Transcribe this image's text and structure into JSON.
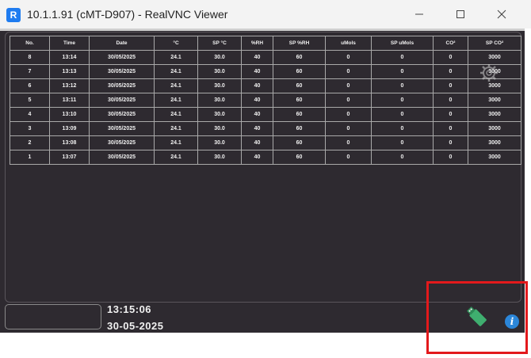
{
  "window": {
    "title": "10.1.1.91 (cMT-D907) - RealVNC Viewer",
    "app_icon_glyph": "R",
    "icons": [
      "realvnc-app-icon",
      "minimize-icon",
      "maximize-icon",
      "close-icon"
    ]
  },
  "table": {
    "headers": [
      "No.",
      "Time",
      "Date",
      "°C",
      "SP °C",
      "%RH",
      "SP %RH",
      "uMols",
      "SP uMols",
      "CO²",
      "SP CO²"
    ],
    "rows": [
      [
        "8",
        "13:14",
        "30/05/2025",
        "24.1",
        "30.0",
        "40",
        "60",
        "0",
        "0",
        "0",
        "3000"
      ],
      [
        "7",
        "13:13",
        "30/05/2025",
        "24.1",
        "30.0",
        "40",
        "60",
        "0",
        "0",
        "0",
        "3000"
      ],
      [
        "6",
        "13:12",
        "30/05/2025",
        "24.1",
        "30.0",
        "40",
        "60",
        "0",
        "0",
        "0",
        "3000"
      ],
      [
        "5",
        "13:11",
        "30/05/2025",
        "24.1",
        "30.0",
        "40",
        "60",
        "0",
        "0",
        "0",
        "3000"
      ],
      [
        "4",
        "13:10",
        "30/05/2025",
        "24.1",
        "30.0",
        "40",
        "60",
        "0",
        "0",
        "0",
        "3000"
      ],
      [
        "3",
        "13:09",
        "30/05/2025",
        "24.1",
        "30.0",
        "40",
        "60",
        "0",
        "0",
        "0",
        "3000"
      ],
      [
        "2",
        "13:08",
        "30/05/2025",
        "24.1",
        "30.0",
        "40",
        "60",
        "0",
        "0",
        "0",
        "3000"
      ],
      [
        "1",
        "13:07",
        "30/05/2025",
        "24.1",
        "30.0",
        "40",
        "60",
        "0",
        "0",
        "0",
        "3000"
      ]
    ]
  },
  "status": {
    "time": "13:15:06",
    "date": "30-05-2025",
    "info_glyph": "i"
  },
  "colors": {
    "hmi_background": "#2e2a30",
    "usb_icon": "#3fae6f",
    "info_icon": "#2b86d9",
    "highlight": "#e3191c"
  },
  "icons": [
    "settings-gear-icon",
    "usb-drive-icon",
    "info-icon"
  ]
}
